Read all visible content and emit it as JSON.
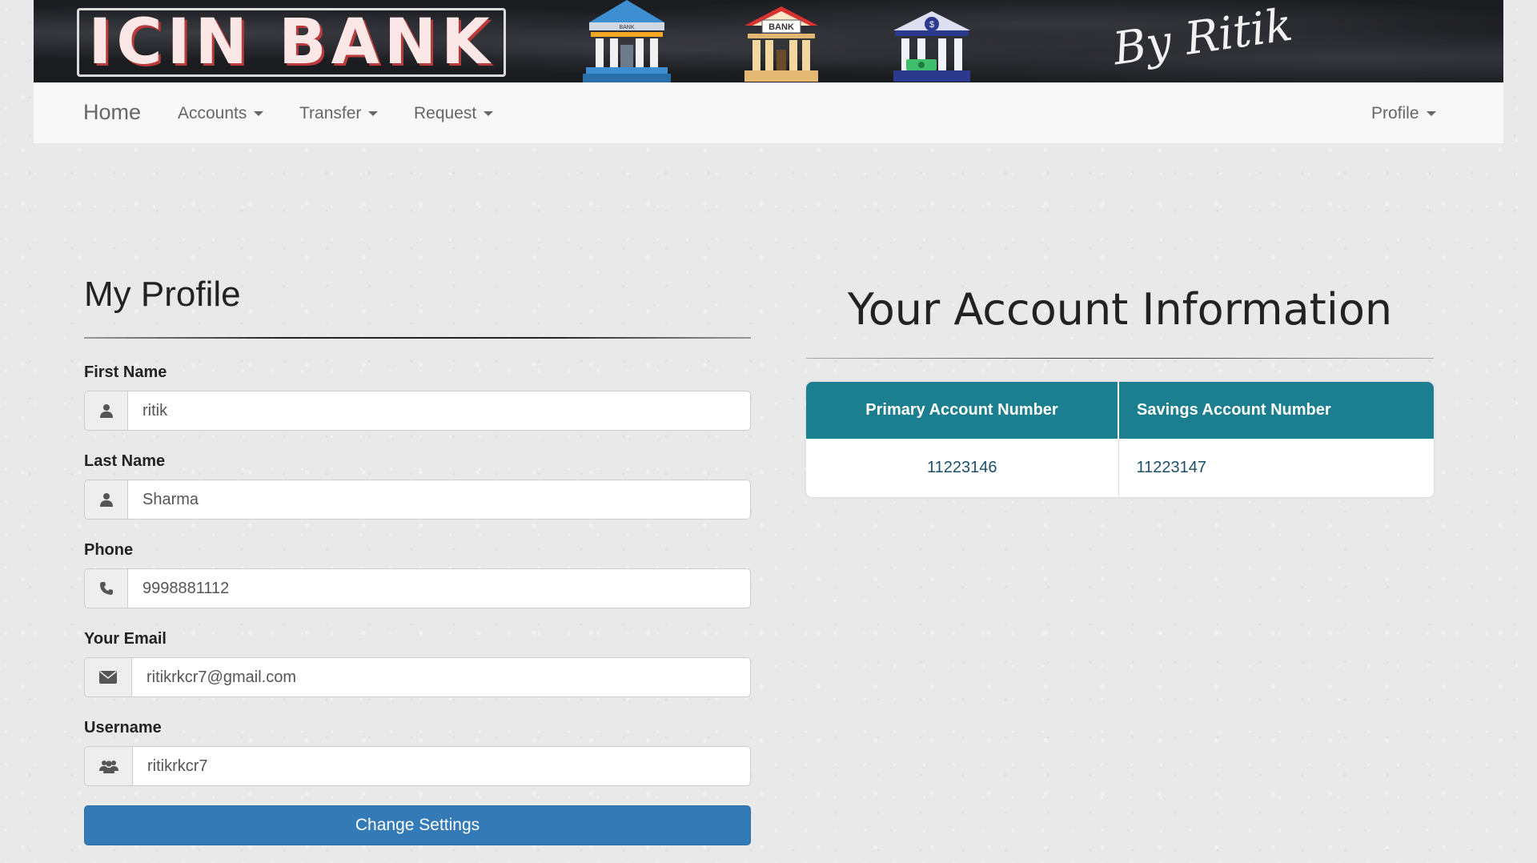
{
  "banner": {
    "logo_text": "ICIN BANK",
    "signature": "By Ritik",
    "bank_sign": "BANK",
    "bank_sign_small": "BANK"
  },
  "navbar": {
    "brand": "Home",
    "items": [
      {
        "label": "Accounts"
      },
      {
        "label": "Transfer"
      },
      {
        "label": "Request"
      }
    ],
    "profile": "Profile"
  },
  "profile_form": {
    "title": "My Profile",
    "fields": [
      {
        "label": "First Name",
        "value": "ritik",
        "icon": "user-icon"
      },
      {
        "label": "Last Name",
        "value": "Sharma",
        "icon": "user-icon"
      },
      {
        "label": "Phone",
        "value": "9998881112",
        "icon": "phone-icon"
      },
      {
        "label": "Your Email",
        "value": "ritikrkcr7@gmail.com",
        "icon": "envelope-icon"
      },
      {
        "label": "Username",
        "value": "ritikrkcr7",
        "icon": "users-icon"
      }
    ],
    "submit_label": "Change Settings"
  },
  "account_info": {
    "title": "Your Account Information",
    "headers": [
      "Primary Account Number",
      "Savings Account Number"
    ],
    "rows": [
      [
        "11223146",
        "11223147"
      ]
    ]
  },
  "colors": {
    "primary_button": "#337ab7",
    "table_header": "#1b7f8f",
    "banner_bg": "#1b1c20"
  }
}
